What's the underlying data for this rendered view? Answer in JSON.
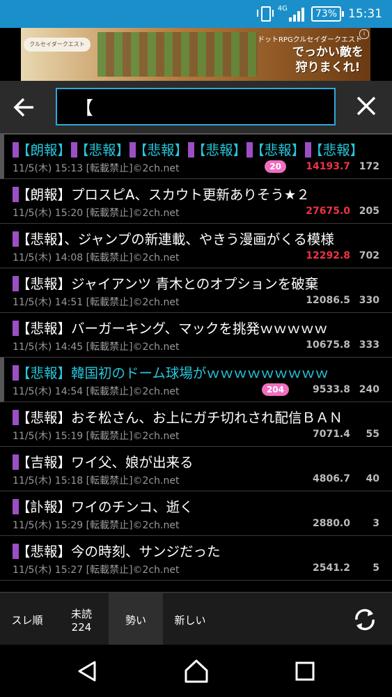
{
  "status": {
    "network": "4G",
    "battery": "73%",
    "time": "15:31"
  },
  "ad": {
    "logo": "クルセイダークエスト",
    "line1": "ドットRPGクルセイダークエスト",
    "line2": "でっかい敵を",
    "line3": "狩りまくれ!",
    "info": "i"
  },
  "search": {
    "value": "【",
    "placeholder": ""
  },
  "threads": [
    {
      "title": "【朗報】【悲報】【悲報】【悲報】【悲報】【悲報】",
      "meta": "11/5(木) 15:13 [転載禁止]©2ch.net",
      "badge": "20",
      "hot": "14193.7",
      "hot_color": "red",
      "count": "172",
      "active": true
    },
    {
      "title": "【朗報】プロスピA、スカウト更新ありそう★２",
      "meta": "11/5(木) 15:20 [転載禁止]©2ch.net",
      "badge": "",
      "hot": "27675.0",
      "hot_color": "red",
      "count": "205",
      "active": false
    },
    {
      "title": "【悲報】、ジャンプの新連載、やきう漫画がくる模様",
      "meta": "11/5(木) 14:08 [転載禁止]©2ch.net",
      "badge": "",
      "hot": "12292.8",
      "hot_color": "red",
      "count": "702",
      "active": false
    },
    {
      "title": "【悲報】ジャイアンツ 青木とのオプションを破棄",
      "meta": "11/5(木) 14:51 [転載禁止]©2ch.net",
      "badge": "",
      "hot": "12086.5",
      "hot_color": "gray",
      "count": "330",
      "active": false
    },
    {
      "title": "【悲報】バーガーキング、マックを挑発ｗｗｗｗｗ",
      "meta": "11/5(木) 14:45 [転載禁止]©2ch.net",
      "badge": "",
      "hot": "10675.8",
      "hot_color": "gray",
      "count": "333",
      "active": false
    },
    {
      "title": "【悲報】韓国初のドーム球場がｗｗｗｗｗｗｗｗｗ",
      "meta": "11/5(木) 14:54 [転載禁止]©2ch.net",
      "badge": "204",
      "hot": "9533.8",
      "hot_color": "gray",
      "count": "240",
      "active": true
    },
    {
      "title": "【悲報】おそ松さん、お上にガチ切れされ配信ＢＡＮ",
      "meta": "11/5(木) 15:19 [転載禁止]©2ch.net",
      "badge": "",
      "hot": "7071.4",
      "hot_color": "gray",
      "count": "55",
      "active": false
    },
    {
      "title": "【吉報】ワイ父、娘が出来る",
      "meta": "11/5(木) 15:18 [転載禁止]©2ch.net",
      "badge": "",
      "hot": "4806.7",
      "hot_color": "gray",
      "count": "40",
      "active": false
    },
    {
      "title": "【訃報】ワイのチンコ、逝く",
      "meta": "11/5(木) 15:29 [転載禁止]©2ch.net",
      "badge": "",
      "hot": "2880.0",
      "hot_color": "gray",
      "count": "3",
      "active": false
    },
    {
      "title": "【悲報】今の時刻、サンジだった",
      "meta": "11/5(木) 15:27 [転載禁止]©2ch.net",
      "badge": "",
      "hot": "2541.2",
      "hot_color": "gray",
      "count": "5",
      "active": false
    }
  ],
  "tabs": [
    {
      "label": "スレ順",
      "sub": ""
    },
    {
      "label": "未読",
      "sub": "224"
    },
    {
      "label": "勢い",
      "sub": ""
    },
    {
      "label": "新しい",
      "sub": ""
    }
  ],
  "colors": {
    "accent": "#1b8fc9",
    "highlight": "#26c6da",
    "badge": "#f06ec0",
    "hot": "#ee3344",
    "mark": "#9c4fc4"
  },
  "icons": {
    "back": "arrow-left-icon",
    "close": "close-icon",
    "refresh": "refresh-icon",
    "nav_back": "triangle-back-icon",
    "nav_home": "home-icon",
    "nav_recent": "square-recent-icon"
  }
}
